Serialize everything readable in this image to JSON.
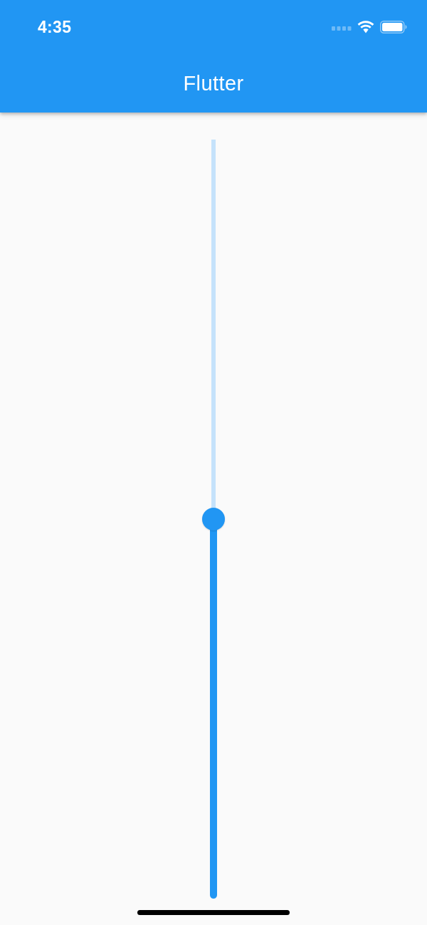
{
  "status_bar": {
    "time": "4:35"
  },
  "app_bar": {
    "title": "Flutter"
  },
  "slider": {
    "level": 0.5
  }
}
